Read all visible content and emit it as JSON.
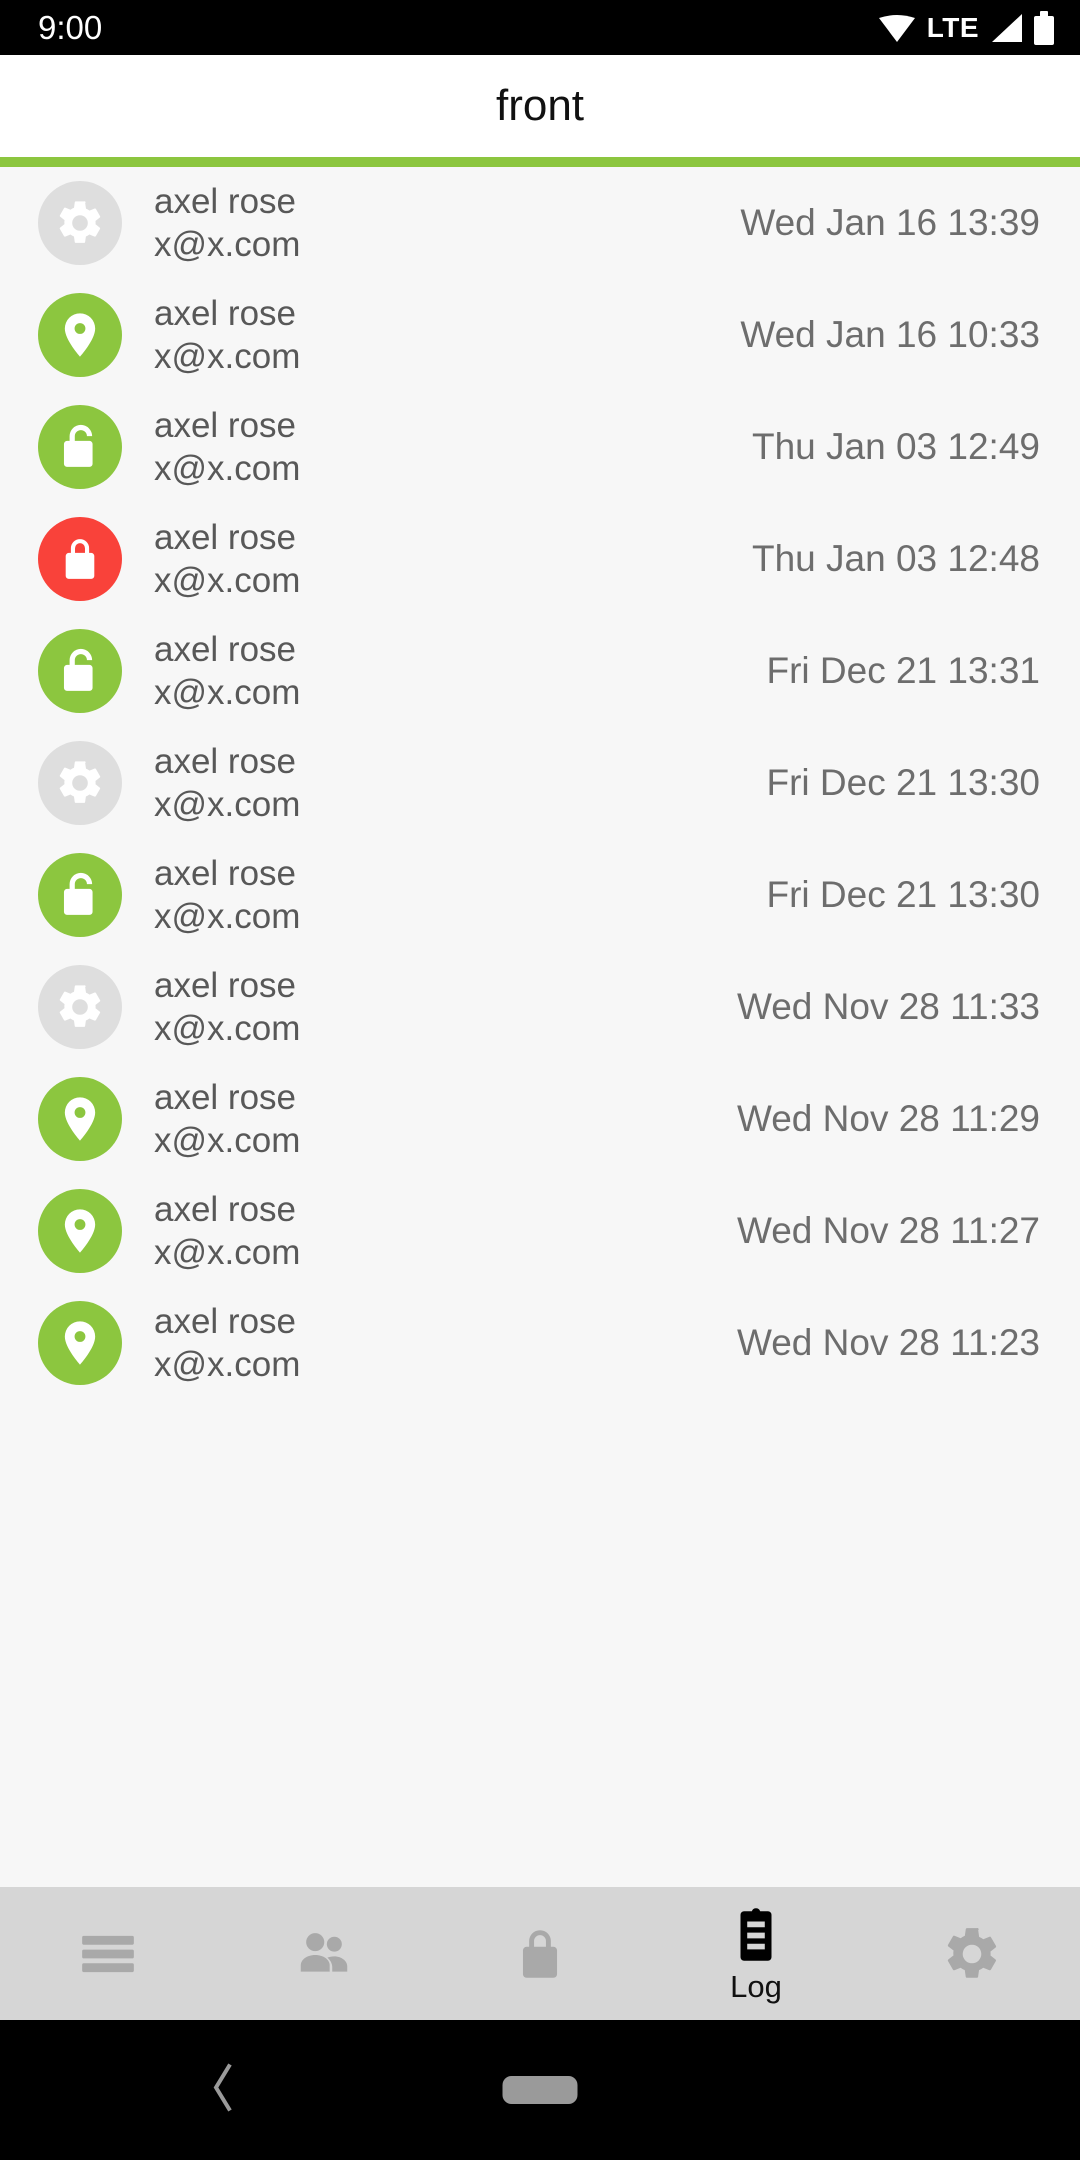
{
  "status_bar": {
    "clock": "9:00",
    "network_label": "LTE",
    "icons": [
      "wifi-icon",
      "signal-icon",
      "battery-icon"
    ]
  },
  "app_bar": {
    "title": "front",
    "accent_color": "#8CC63F"
  },
  "colors": {
    "accent_green": "#8CC63F",
    "alert_red": "#F9423A",
    "neutral_grey": "#DEDEDE",
    "list_background": "#F7F7F7",
    "tabbar_background": "#D6D6D6"
  },
  "log_list": {
    "rows": [
      {
        "icon": "gear-icon",
        "icon_color": "grey",
        "name": "axel rose",
        "email": "x@x.com",
        "timestamp": "Wed Jan 16 13:39"
      },
      {
        "icon": "location-pin-icon",
        "icon_color": "green",
        "name": "axel rose",
        "email": "x@x.com",
        "timestamp": "Wed Jan 16 10:33"
      },
      {
        "icon": "unlock-icon",
        "icon_color": "green",
        "name": "axel rose",
        "email": "x@x.com",
        "timestamp": "Thu Jan 03 12:49"
      },
      {
        "icon": "lock-icon",
        "icon_color": "red",
        "name": "axel rose",
        "email": "x@x.com",
        "timestamp": "Thu Jan 03 12:48"
      },
      {
        "icon": "unlock-icon",
        "icon_color": "green",
        "name": "axel rose",
        "email": "x@x.com",
        "timestamp": "Fri Dec 21 13:31"
      },
      {
        "icon": "gear-icon",
        "icon_color": "grey",
        "name": "axel rose",
        "email": "x@x.com",
        "timestamp": "Fri Dec 21 13:30"
      },
      {
        "icon": "unlock-icon",
        "icon_color": "green",
        "name": "axel rose",
        "email": "x@x.com",
        "timestamp": "Fri Dec 21 13:30"
      },
      {
        "icon": "gear-icon",
        "icon_color": "grey",
        "name": "axel rose",
        "email": "x@x.com",
        "timestamp": "Wed Nov 28 11:33"
      },
      {
        "icon": "location-pin-icon",
        "icon_color": "green",
        "name": "axel rose",
        "email": "x@x.com",
        "timestamp": "Wed Nov 28 11:29"
      },
      {
        "icon": "location-pin-icon",
        "icon_color": "green",
        "name": "axel rose",
        "email": "x@x.com",
        "timestamp": "Wed Nov 28 11:27"
      },
      {
        "icon": "location-pin-icon",
        "icon_color": "green",
        "name": "axel rose",
        "email": "x@x.com",
        "timestamp": "Wed Nov 28 11:23"
      }
    ]
  },
  "tab_bar": {
    "tabs": [
      {
        "icon": "hamburger-menu-icon",
        "label": "",
        "active": false
      },
      {
        "icon": "people-icon",
        "label": "",
        "active": false
      },
      {
        "icon": "lock-icon",
        "label": "",
        "active": false
      },
      {
        "icon": "clipboard-log-icon",
        "label": "Log",
        "active": true
      },
      {
        "icon": "gear-icon",
        "label": "",
        "active": false
      }
    ]
  },
  "android_nav": {
    "back": "back-chevron-icon",
    "home": "home-pill-icon"
  }
}
